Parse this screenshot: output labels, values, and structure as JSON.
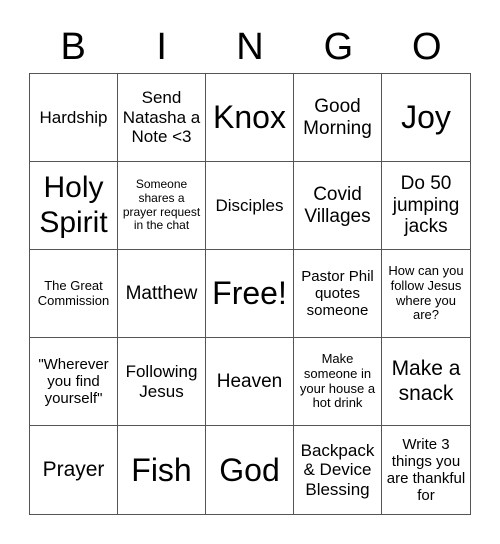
{
  "header": [
    "B",
    "I",
    "N",
    "G",
    "O"
  ],
  "cells": [
    {
      "text": "Hardship",
      "size": "s4"
    },
    {
      "text": "Send Natasha a Note <3",
      "size": "s4"
    },
    {
      "text": "Knox",
      "size": "s8"
    },
    {
      "text": "Good Morning",
      "size": "s5"
    },
    {
      "text": "Joy",
      "size": "s8"
    },
    {
      "text": "Holy Spirit",
      "size": "s7"
    },
    {
      "text": "Someone shares a prayer request in the chat",
      "size": "s1"
    },
    {
      "text": "Disciples",
      "size": "s4"
    },
    {
      "text": "Covid Villages",
      "size": "s5"
    },
    {
      "text": "Do 50 jumping jacks",
      "size": "s5"
    },
    {
      "text": "The Great Commission",
      "size": "s2"
    },
    {
      "text": "Matthew",
      "size": "s5"
    },
    {
      "text": "Free!",
      "size": "s8"
    },
    {
      "text": "Pastor Phil quotes someone",
      "size": "s3"
    },
    {
      "text": "How can you follow Jesus where you are?",
      "size": "s2"
    },
    {
      "text": "\"Wherever you find yourself\"",
      "size": "s3"
    },
    {
      "text": "Following Jesus",
      "size": "s4"
    },
    {
      "text": "Heaven",
      "size": "s5"
    },
    {
      "text": "Make someone in your house a hot drink",
      "size": "s2"
    },
    {
      "text": "Make a snack",
      "size": "s6"
    },
    {
      "text": "Prayer",
      "size": "s6"
    },
    {
      "text": "Fish",
      "size": "s8"
    },
    {
      "text": "God",
      "size": "s8"
    },
    {
      "text": "Backpack & Device Blessing",
      "size": "s4"
    },
    {
      "text": "Write 3 things you are thankful for",
      "size": "s3"
    }
  ]
}
